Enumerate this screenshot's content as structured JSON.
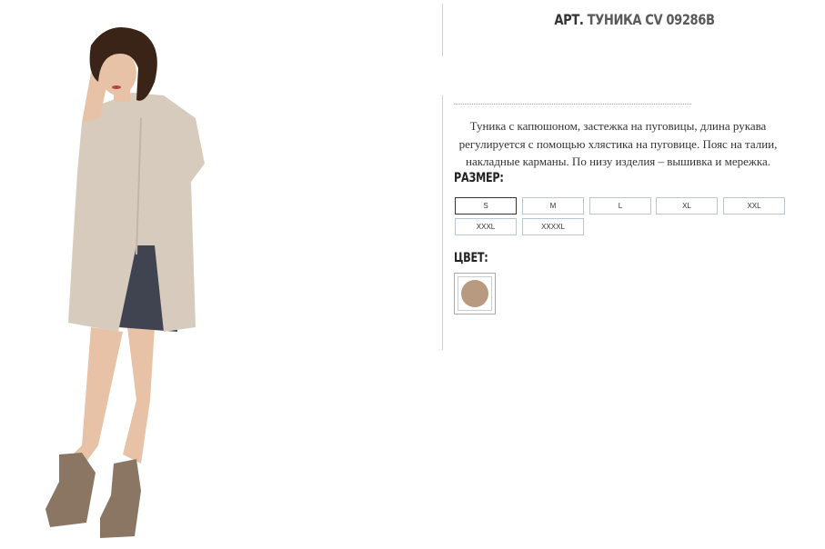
{
  "product": {
    "title_prefix": "АРТ.",
    "title_code": "ТУНИКА CV 09286B",
    "description": "Туника с капюшоном, застежка на пуговицы, длина рукава регулируется с помощью хлястика на пуговице. Пояс на талии, накладные карманы. По низу изделия – вышивка и мережка."
  },
  "size_section": {
    "label": "РАЗМЕР:",
    "options": [
      "S",
      "M",
      "L",
      "XL",
      "XXL",
      "XXXL",
      "XXXXL"
    ],
    "selected": "S"
  },
  "color_section": {
    "label": "ЦВЕТ:",
    "swatch_color": "#b89a80"
  },
  "colors": {
    "tunic": "#d6cbbd",
    "shorts": "#3f4450",
    "skin": "#e7c2a6",
    "hair": "#3a2418",
    "boots": "#8a7663"
  }
}
